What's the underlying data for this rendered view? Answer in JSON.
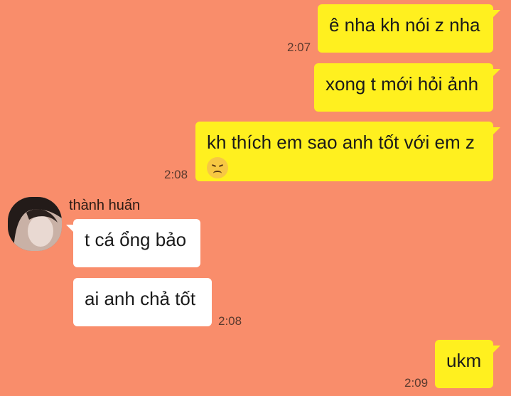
{
  "messages": [
    {
      "text": "ê nha kh nói z nha",
      "time": "2:07"
    },
    {
      "text": "xong t mới hỏi ảnh",
      "time": ""
    },
    {
      "text": "kh thích em sao anh tốt với em z",
      "time": "2:08",
      "emoji": "disappointed-face-emoji"
    },
    {
      "sender": "thành huấn",
      "text": "t cá ổng bảo"
    },
    {
      "text": "ai anh chả tốt",
      "time": "2:08"
    },
    {
      "text": "ukm",
      "time": "2:09"
    }
  ],
  "colors": {
    "background": "#F98D6B",
    "outgoing_bubble": "#FFF01F",
    "incoming_bubble": "#FFFFFF"
  }
}
